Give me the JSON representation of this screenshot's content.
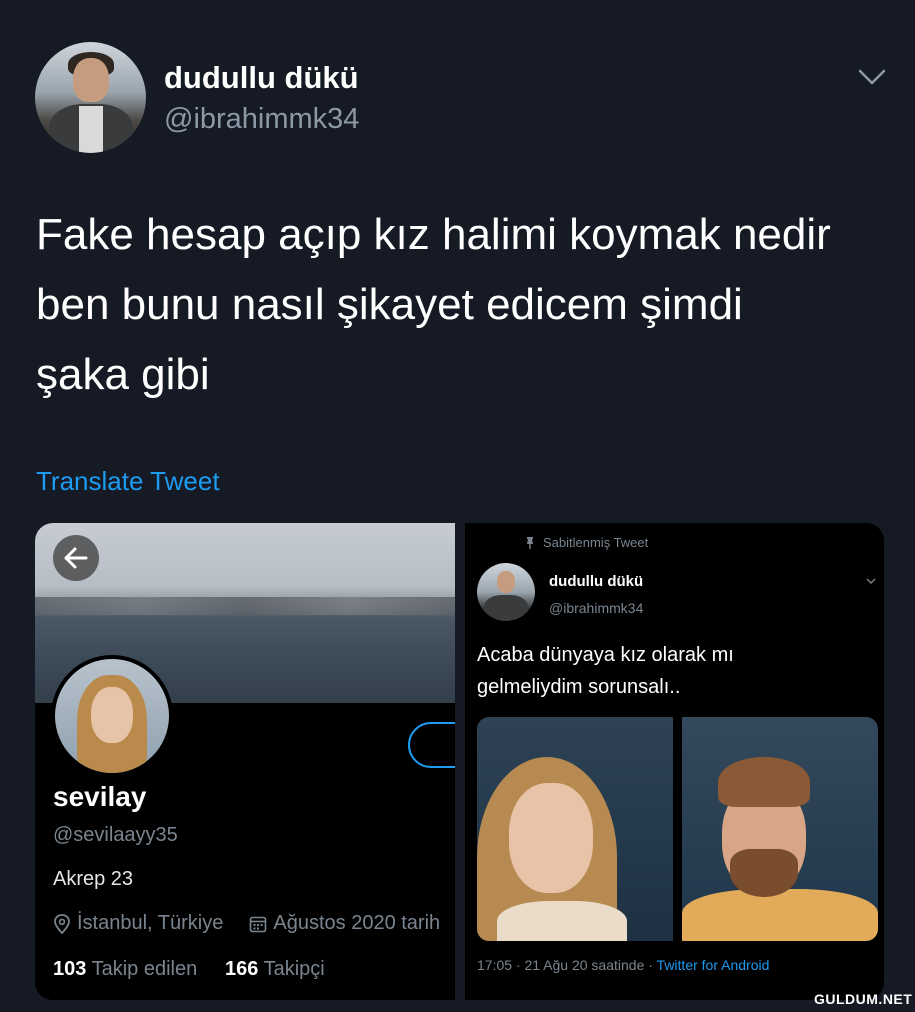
{
  "tweet": {
    "display_name": "dudullu dükü",
    "handle": "@ibrahimmk34",
    "text_lines": [
      "Fake hesap açıp kız halimi koymak nedir",
      "ben bunu nasıl şikayet edicem şimdi",
      "şaka gibi"
    ],
    "translate_label": "Translate Tweet",
    "menu_icon": "chevron-down-icon"
  },
  "screenshot_left": {
    "back_icon": "arrow-left-icon",
    "name": "sevilay",
    "handle": "@sevilaayy35",
    "bio": "Akrep 23",
    "location": "İstanbul, Türkiye",
    "joined": "Ağustos 2020 tarih",
    "following_count": "103",
    "following_label": "Takip edilen",
    "followers_count": "166",
    "followers_label": "Takipçi"
  },
  "screenshot_right": {
    "pinned_label": "Sabitlenmiş Tweet",
    "display_name": "dudullu dükü",
    "handle": "@ibrahimmk34",
    "text_lines": [
      "Acaba dünyaya kız olarak mı",
      "gelmeliydim sorunsalı.."
    ],
    "timestamp": "17:05 · 21 Ağu 20 saatinde · ",
    "source": "Twitter for Android"
  },
  "watermark": "GULDUM.NET",
  "colors": {
    "background": "#151a24",
    "link": "#1d9bf0",
    "secondary_text": "#8b98a5"
  }
}
